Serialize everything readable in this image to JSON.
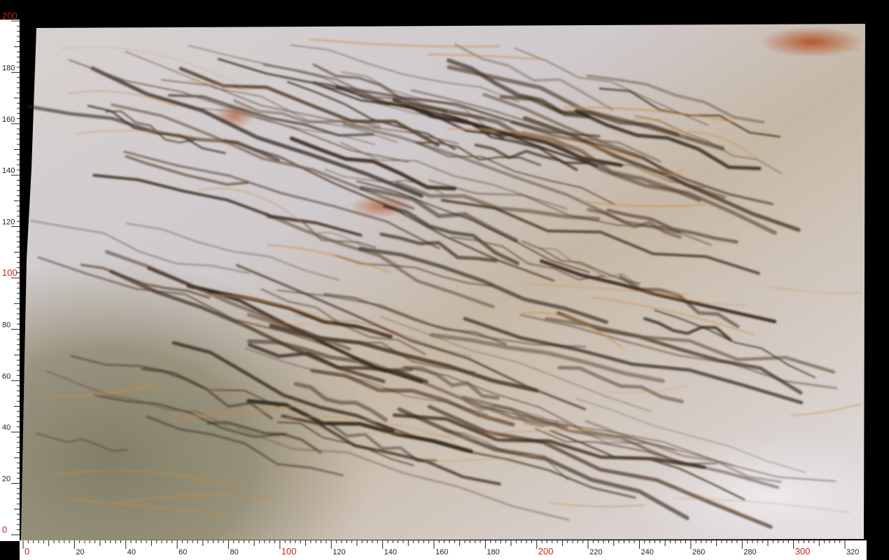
{
  "image": {
    "subject": "marble-slab",
    "colors": {
      "background": "#000000",
      "ruler_bg": "#ffffff",
      "ruler_ink": "#222222",
      "major_label": "#cc1f1f",
      "slab_light": "#d9d6d9",
      "slab_warm": "#c9b49a",
      "slab_green": "#8a8670",
      "vein_dark": "#3a2a1c",
      "vein_rust": "#b0652a"
    }
  },
  "rulers": {
    "unit_hint": "cm",
    "x": {
      "min": 0,
      "max": 320,
      "major_every": 100,
      "label_every": 20,
      "minor_every": 2,
      "labels": [
        "0",
        "20",
        "40",
        "60",
        "80",
        "100",
        "120",
        "140",
        "160",
        "180",
        "200",
        "220",
        "240",
        "260",
        "280",
        "300",
        "320"
      ]
    },
    "y": {
      "min": 0,
      "max": 200,
      "major_every": 100,
      "label_every": 20,
      "minor_every": 2,
      "labels": [
        "0",
        "20",
        "40",
        "60",
        "80",
        "100",
        "120",
        "140",
        "160",
        "180",
        "200"
      ]
    }
  }
}
